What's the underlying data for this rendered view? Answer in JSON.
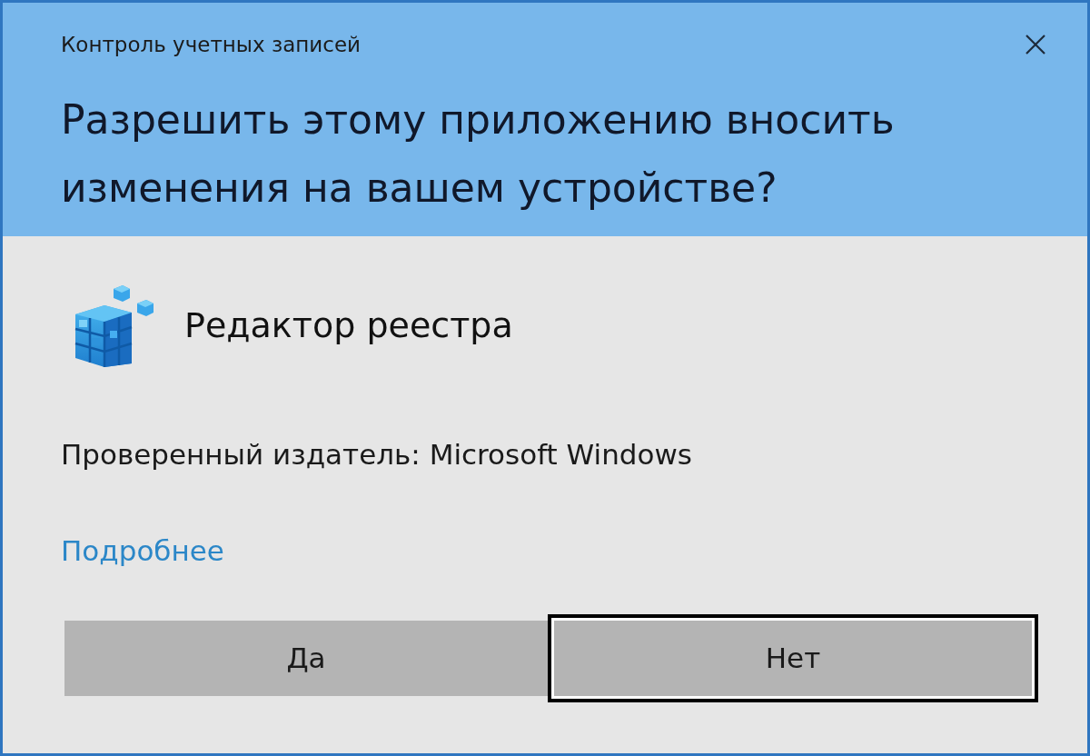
{
  "window": {
    "title": "Контроль учетных записей"
  },
  "heading": "Разрешить этому приложению вносить изменения на вашем устройстве?",
  "app": {
    "name": "Редактор реестра"
  },
  "publisher": "Проверенный издатель: Microsoft Windows",
  "details_link": "Подробнее",
  "buttons": [
    {
      "label": "Да",
      "focused": false
    },
    {
      "label": "Нет",
      "focused": true
    }
  ]
}
